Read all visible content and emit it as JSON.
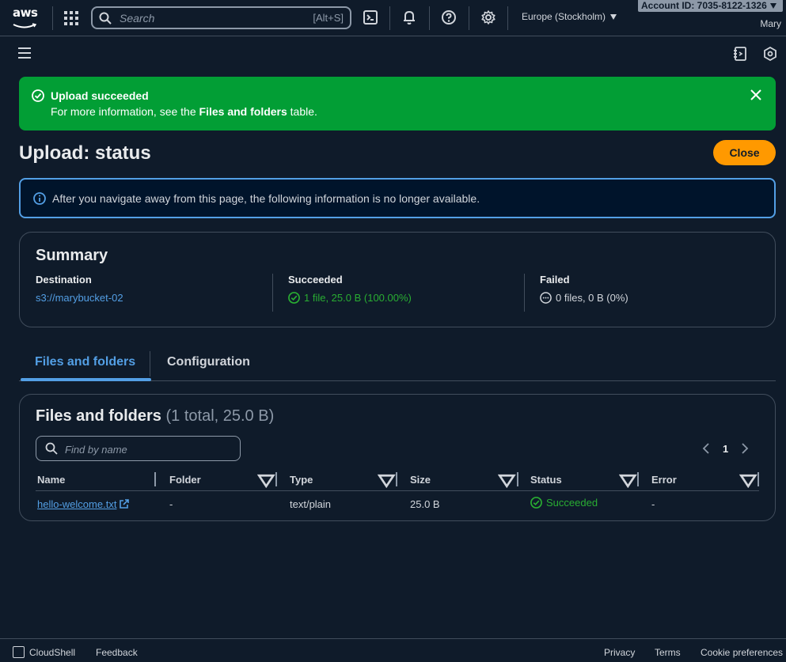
{
  "topnav": {
    "logo_text": "aws",
    "search_placeholder": "Search",
    "search_shortcut": "[Alt+S]",
    "region": "Europe (Stockholm)",
    "account_id": "Account ID: 7035-8122-1326",
    "user": "Mary"
  },
  "flash": {
    "title": "Upload succeeded",
    "body_prefix": "For more information, see the ",
    "body_bold": "Files and folders",
    "body_suffix": " table."
  },
  "page": {
    "title": "Upload: status",
    "close_label": "Close"
  },
  "info": {
    "text": "After you navigate away from this page, the following information is no longer available."
  },
  "summary": {
    "title": "Summary",
    "destination_label": "Destination",
    "destination_value": "s3://marybucket-02",
    "succeeded_label": "Succeeded",
    "succeeded_value": "1 file, 25.0 B (100.00%)",
    "failed_label": "Failed",
    "failed_value": "0 files, 0 B (0%)"
  },
  "tabs": [
    {
      "label": "Files and folders",
      "active": true
    },
    {
      "label": "Configuration",
      "active": false
    }
  ],
  "files": {
    "title": "Files and folders",
    "count": "(1 total, 25.0 B)",
    "find_placeholder": "Find by name",
    "page": "1",
    "columns": [
      "Name",
      "Folder",
      "Type",
      "Size",
      "Status",
      "Error"
    ],
    "rows": [
      {
        "name": "hello-welcome.txt",
        "folder": "-",
        "type": "text/plain",
        "size": "25.0 B",
        "status": "Succeeded",
        "error": "-"
      }
    ]
  },
  "footer": {
    "cloudshell": "CloudShell",
    "feedback": "Feedback",
    "privacy": "Privacy",
    "terms": "Terms",
    "cookies": "Cookie preferences"
  },
  "colors": {
    "background": "#0f1b2a",
    "success": "#029e35",
    "accent_link": "#539fe5",
    "primary_button": "#ff9900"
  }
}
